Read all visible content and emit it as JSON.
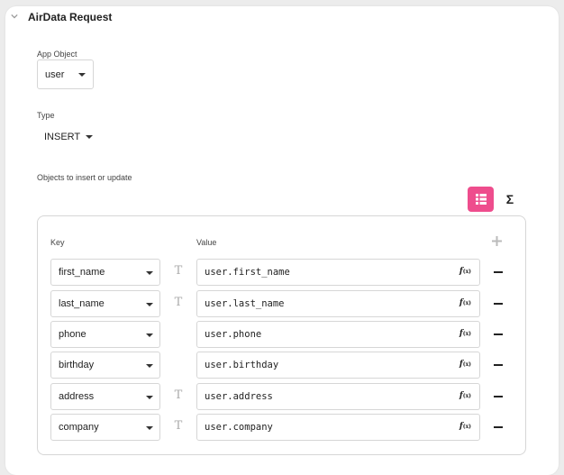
{
  "section": {
    "title": "AirData Request",
    "collapse_icon": "chevron-down-icon"
  },
  "app_object": {
    "label": "App Object",
    "value": "user"
  },
  "type": {
    "label": "Type",
    "value": "INSERT"
  },
  "objects": {
    "label": "Objects to insert or update",
    "grid_icon": "grid-list-icon",
    "sigma_label": "Σ",
    "key_header": "Key",
    "value_header": "Value",
    "add_icon": "plus-icon",
    "rows": [
      {
        "key": "first_name",
        "value": "user.first_name",
        "text_type_icon": true
      },
      {
        "key": "last_name",
        "value": "user.last_name",
        "text_type_icon": true
      },
      {
        "key": "phone",
        "value": "user.phone",
        "text_type_icon": false
      },
      {
        "key": "birthday",
        "value": "user.birthday",
        "text_type_icon": false
      },
      {
        "key": "address",
        "value": "user.address",
        "text_type_icon": true
      },
      {
        "key": "company",
        "value": "user.company",
        "text_type_icon": true
      }
    ]
  },
  "colors": {
    "accent": "#ee4d8d",
    "border": "#d6d6d6",
    "background": "#ececec"
  }
}
